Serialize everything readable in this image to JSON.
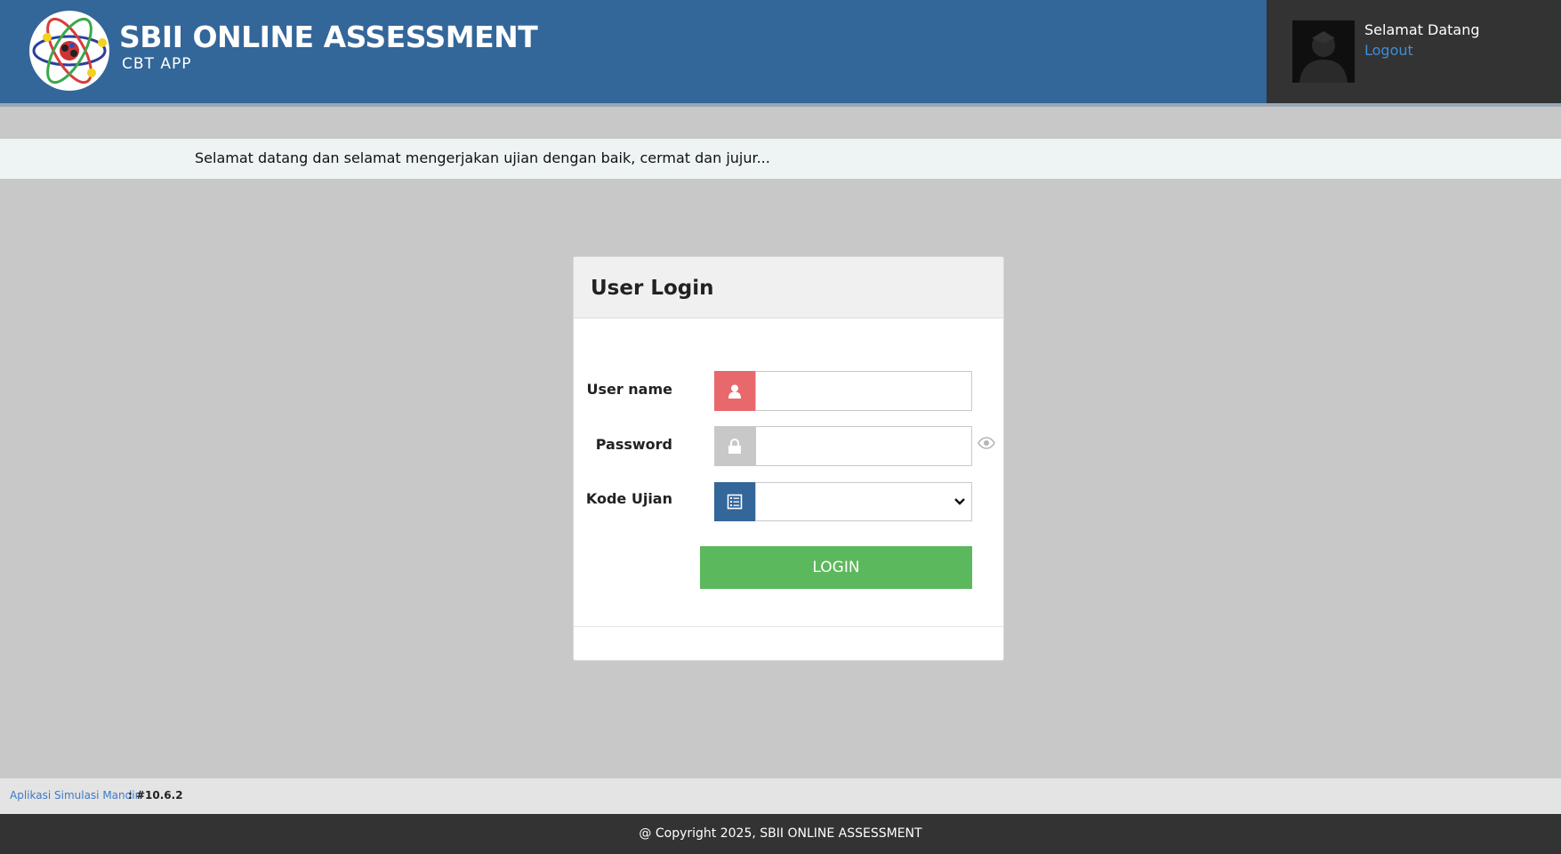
{
  "header": {
    "title": "SBII ONLINE ASSESSMENT",
    "subtitle": "CBT  APP",
    "welcome": "Selamat Datang",
    "logout_label": "Logout"
  },
  "marquee": {
    "text": "Selamat datang dan selamat mengerjakan ujian dengan baik, cermat dan jujur..."
  },
  "login": {
    "title": "User Login",
    "username_label": "User name",
    "username_value": "",
    "password_label": "Password",
    "password_value": "",
    "exam_code_label": "Kode Ujian",
    "exam_code_selected": "",
    "button_label": "LOGIN"
  },
  "footer": {
    "app_link": "Aplikasi Simulasi Mandiri",
    "version": ": #10.6.2",
    "copyright": "@ Copyright 2025, SBII ONLINE ASSESSMENT"
  },
  "colors": {
    "header_blue": "#336699",
    "header_dark": "#333333",
    "user_addon": "#e8696b",
    "password_addon": "#c8c8c8",
    "exam_addon": "#336699",
    "login_button": "#5cb85c",
    "background": "#c8c8c8"
  },
  "icons": {
    "logo": "atom-logo-icon",
    "avatar": "user-silhouette-icon",
    "username": "user-icon",
    "password": "lock-icon",
    "exam_code": "list-icon",
    "show_password": "eye-icon",
    "dropdown": "chevron-down-icon"
  }
}
